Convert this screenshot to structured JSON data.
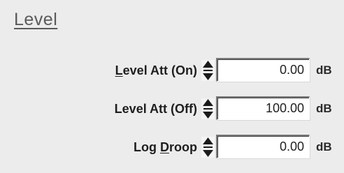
{
  "section": {
    "title": "Level"
  },
  "rows": [
    {
      "label_underlined": "L",
      "label_rest": "evel Att (On)",
      "value": "0.00",
      "unit": "dB"
    },
    {
      "label_pre": "Level Att (Off)",
      "value": "100.00",
      "unit": "dB"
    },
    {
      "label_pre": "Log ",
      "label_underlined": "D",
      "label_rest": "roop",
      "value": "0.00",
      "unit": "dB"
    }
  ],
  "icons": {
    "spinner": "up-down-spinner-icon"
  }
}
